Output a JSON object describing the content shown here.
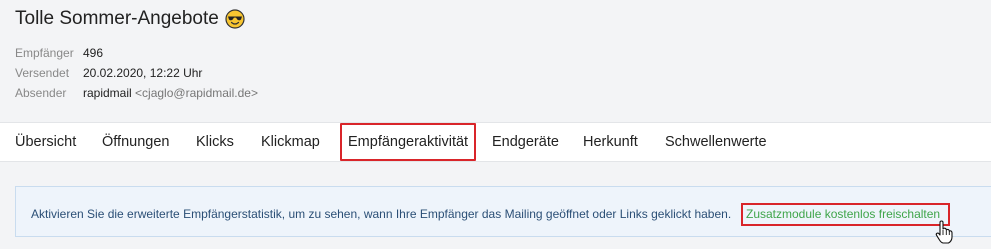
{
  "mailing": {
    "title": "Tolle Sommer-Angebote",
    "emoji_icon": "smiling-face-with-sunglasses-icon"
  },
  "meta": [
    {
      "label": "Empfänger",
      "value": "496"
    },
    {
      "label": "Versendet",
      "value": "20.02.2020, 12:22 Uhr"
    },
    {
      "label": "Absender",
      "value": "rapidmail",
      "email": "<cjaglo@rapidmail.de>"
    }
  ],
  "tabs": [
    {
      "label": "Übersicht"
    },
    {
      "label": "Öffnungen"
    },
    {
      "label": "Klicks"
    },
    {
      "label": "Klickmap"
    },
    {
      "label": "Empfängeraktivität",
      "highlighted": true
    },
    {
      "label": "Endgeräte"
    },
    {
      "label": "Herkunft"
    },
    {
      "label": "Schwellenwerte"
    }
  ],
  "notice": {
    "text": "Aktivieren Sie die erweiterte Empfängerstatistik, um zu sehen, wann Ihre Empfänger das Mailing geöffnet oder Links geklickt haben.",
    "link": "Zusatzmodule kostenlos freischalten"
  },
  "colors": {
    "highlight": "#d9252a",
    "link": "#3fa54a",
    "notice_text": "#2b4f76",
    "notice_bg": "#eef4fb"
  }
}
